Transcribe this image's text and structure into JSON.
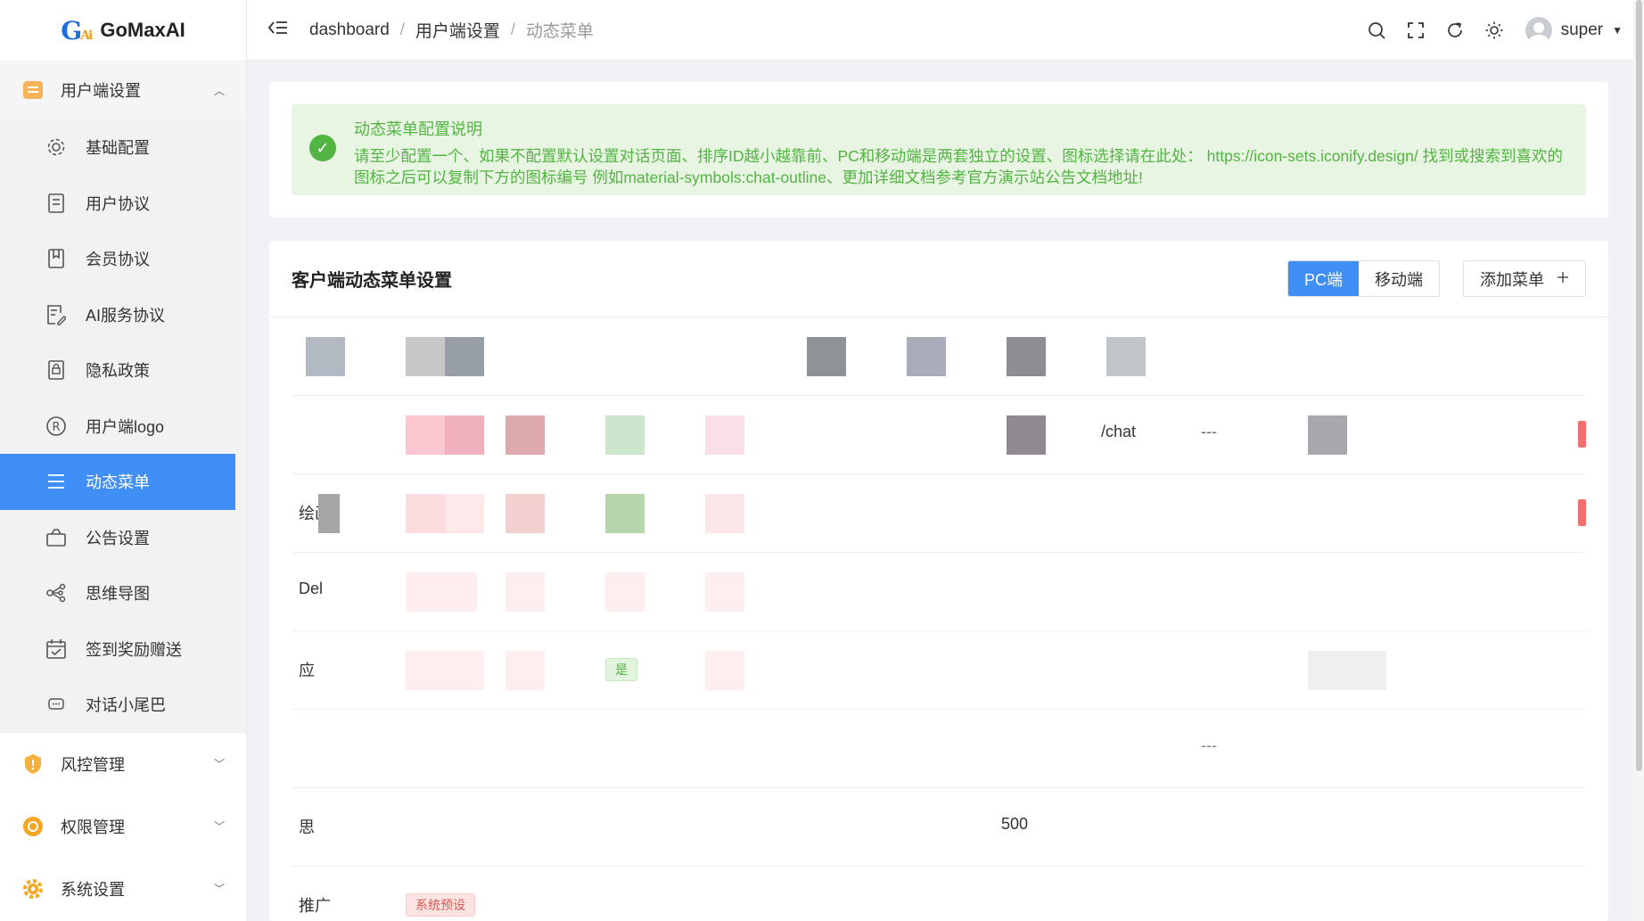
{
  "app": {
    "brand_mark": "G",
    "brand_mark_sub": "Ai",
    "brand_name": "GoMaxAI"
  },
  "sidebar": {
    "group_user": "用户端设置",
    "items": [
      {
        "label": "基础配置",
        "icon": "gear-icon"
      },
      {
        "label": "用户协议",
        "icon": "document-icon"
      },
      {
        "label": "会员协议",
        "icon": "bookmark-doc-icon"
      },
      {
        "label": "AI服务协议",
        "icon": "edit-doc-icon"
      },
      {
        "label": "隐私政策",
        "icon": "lock-doc-icon"
      },
      {
        "label": "用户端logo",
        "icon": "registered-icon"
      },
      {
        "label": "动态菜单",
        "icon": "menu-icon",
        "active": true
      },
      {
        "label": "公告设置",
        "icon": "bag-icon"
      },
      {
        "label": "思维导图",
        "icon": "share-icon"
      },
      {
        "label": "签到奖励赠送",
        "icon": "calendar-icon"
      },
      {
        "label": "对话小尾巴",
        "icon": "chat-icon"
      }
    ],
    "group_risk": "风控管理",
    "group_perm": "权限管理",
    "group_sys": "系统设置"
  },
  "header": {
    "crumb1": "dashboard",
    "crumb2": "用户端设置",
    "crumb3": "动态菜单",
    "sep": "/",
    "user": "super"
  },
  "notice": {
    "title": "动态菜单配置说明",
    "desc": "请至少配置一个、如果不配置默认设置对话页面、排序ID越小越靠前、PC和移动端是两套独立的设置、图标选择请在此处： https://icon-sets.iconify.design/ 找到或搜索到喜欢的图标之后可以复制下方的图标编号 例如material-symbols:chat-outline、更加详细文档参考官方演示站公告文档地址!"
  },
  "menu_card": {
    "title": "客户端动态菜单设置",
    "tab_pc": "PC端",
    "tab_mobile": "移动端",
    "add_label": "添加菜单",
    "add_icon": "plus-icon"
  },
  "table": {
    "row1_path": "/chat",
    "row1_dash": "---",
    "row2_name": "绘画",
    "row3_name": "Del",
    "row4_name": "应",
    "row4_tag": "是",
    "row5_dash": "---",
    "row6_name": "思",
    "row6_num": "500",
    "row7_name": "推广",
    "row7_tag": "系统预设"
  },
  "colors": {
    "accent": "#3f8ff7",
    "success": "#52b442",
    "danger": "#e0584f"
  }
}
